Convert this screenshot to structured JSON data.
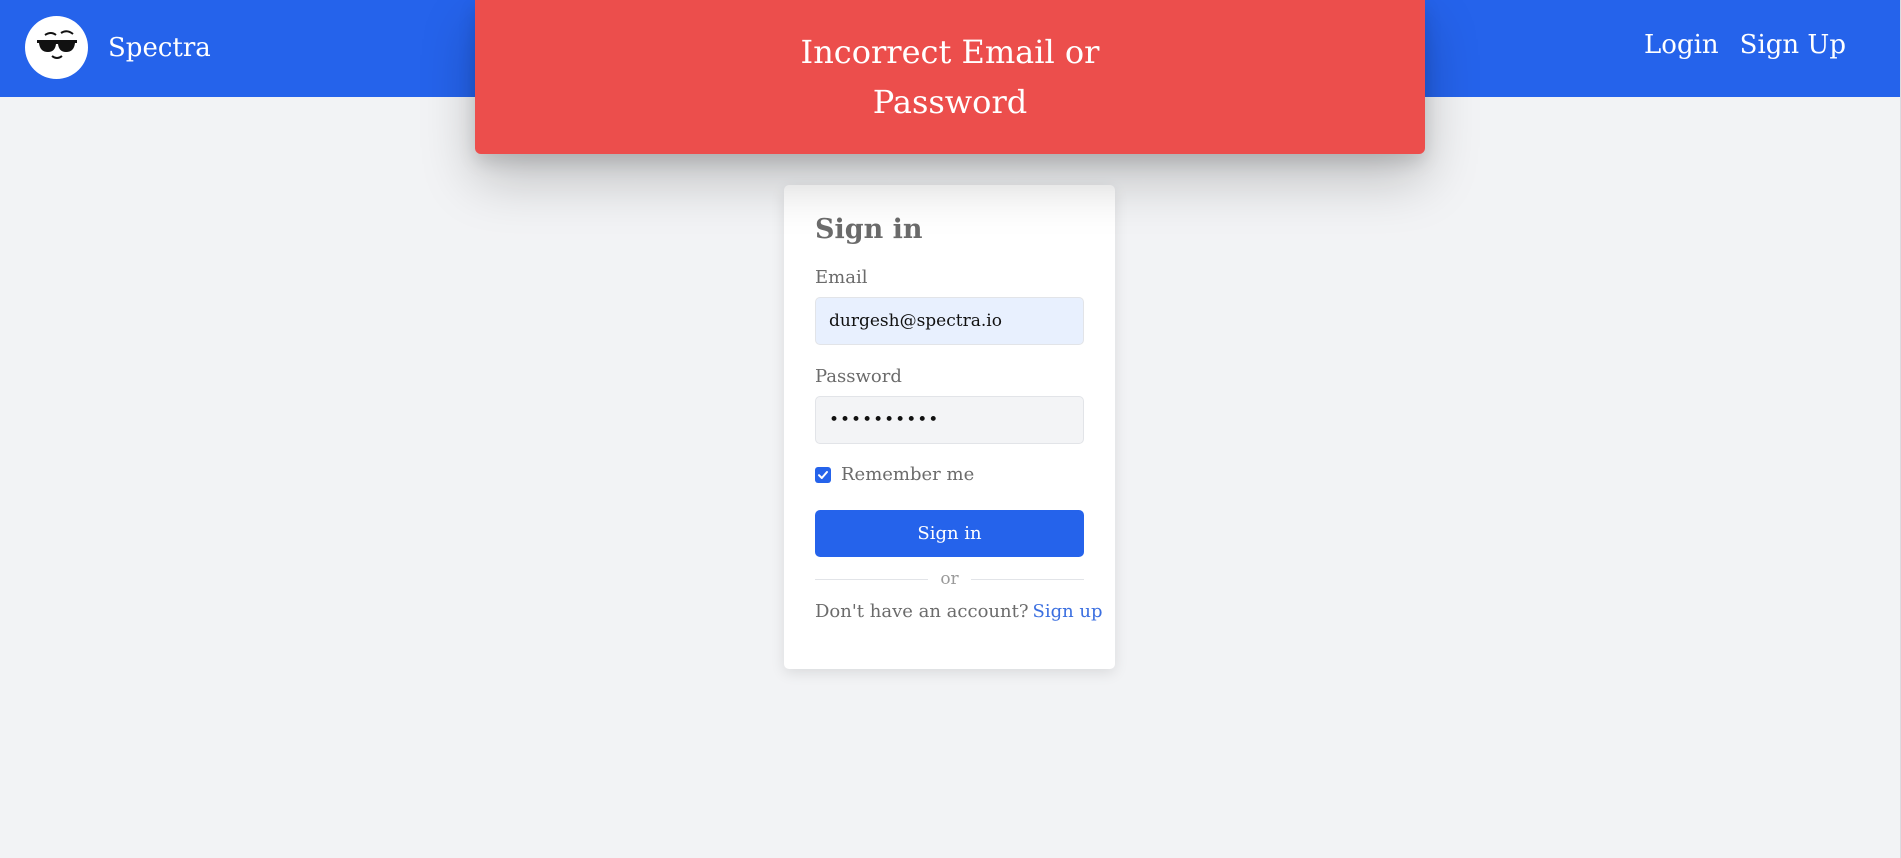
{
  "navbar": {
    "brand_name": "Spectra",
    "logo_caption": "GLASSES",
    "links": [
      "Login",
      "Sign Up"
    ]
  },
  "toast": {
    "message": "Incorrect Email or Password"
  },
  "signin_form": {
    "title": "Sign in",
    "email_label": "Email",
    "email_value": "durgesh@spectra.io",
    "password_label": "Password",
    "password_value": "••••••••••",
    "remember_label": "Remember me",
    "remember_checked": true,
    "submit_label": "Sign in",
    "divider_text": "or",
    "no_account_text": "Don't have an account?",
    "signup_link": "Sign up"
  },
  "colors": {
    "primary": "#2563eb",
    "toast_error": "#ec4e4c",
    "page_background": "#f2f3f5"
  }
}
